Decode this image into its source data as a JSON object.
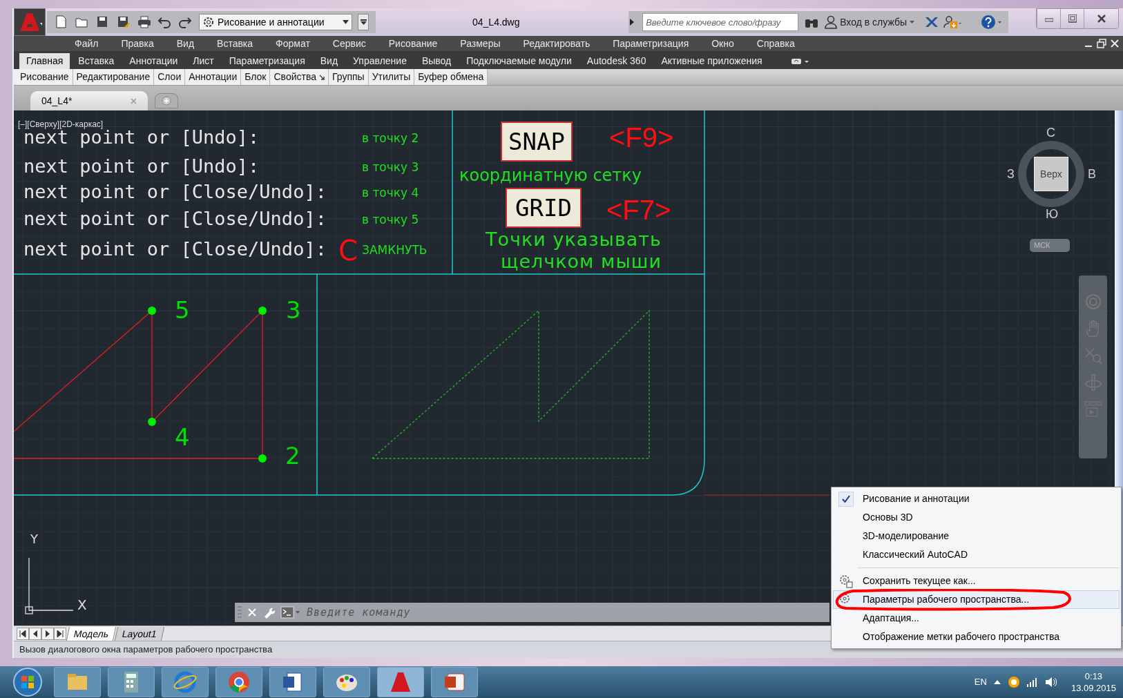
{
  "title_bar": {
    "workspace": "Рисование и аннотации",
    "document_title": "04_L4.dwg",
    "search": {
      "placeholder": "Введите ключевое слово/фразу"
    },
    "sign_in": "Вход в службы"
  },
  "menu_bar": [
    "Файл",
    "Правка",
    "Вид",
    "Вставка",
    "Формат",
    "Сервис",
    "Рисование",
    "Размеры",
    "Редактировать",
    "Параметризация",
    "Окно",
    "Справка"
  ],
  "ribbon_tabs": [
    {
      "label": "Главная",
      "selected": true
    },
    {
      "label": "Вставка",
      "selected": false
    },
    {
      "label": "Аннотации",
      "selected": false
    },
    {
      "label": "Лист",
      "selected": false
    },
    {
      "label": "Параметризация",
      "selected": false
    },
    {
      "label": "Вид",
      "selected": false
    },
    {
      "label": "Управление",
      "selected": false
    },
    {
      "label": "Вывод",
      "selected": false
    },
    {
      "label": "Подключаемые модули",
      "selected": false
    },
    {
      "label": "Autodesk 360",
      "selected": false
    },
    {
      "label": "Активные приложения",
      "selected": false
    }
  ],
  "ribbon_panels": [
    {
      "label": "Рисование",
      "launcher": false
    },
    {
      "label": "Редактирование",
      "launcher": false
    },
    {
      "label": "Слои",
      "launcher": false
    },
    {
      "label": "Аннотации",
      "launcher": false
    },
    {
      "label": "Блок",
      "launcher": false
    },
    {
      "label": "Свойства",
      "launcher": true
    },
    {
      "label": "Группы",
      "launcher": false
    },
    {
      "label": "Утилиты",
      "launcher": false
    },
    {
      "label": "Буфер обмена",
      "launcher": false
    }
  ],
  "file_tabs": [
    {
      "label": "04_L4*",
      "selected": true
    }
  ],
  "viewport_label": "[–][Сверху][2D-каркас]",
  "command_history": [
    {
      "prompt": "next point or [Undo]:",
      "note": "в точку 2"
    },
    {
      "prompt": "next point or [Undo]:",
      "note": "в точку 3"
    },
    {
      "prompt": "next point or [Close/Undo]:",
      "note": "в точку 4"
    },
    {
      "prompt": "next point or [Close/Undo]:",
      "note": "в точку 5"
    },
    {
      "prompt": "next point or [Close/Undo]:",
      "input": "C",
      "note": "ЗАМКНУТЬ"
    }
  ],
  "snap": {
    "button": "SNAP",
    "shortcut": "<F9>",
    "caption": "координатную сетку"
  },
  "grid": {
    "button": "GRID",
    "shortcut": "<F7>",
    "caption": [
      "Точки указывать",
      "щелчком мыши"
    ]
  },
  "point_labels": [
    "5",
    "3",
    "4",
    "2"
  ],
  "ucs_icon": {
    "y_label": "Y",
    "x_label": "X"
  },
  "viewcube": {
    "north": "С",
    "west": "З",
    "east": "В",
    "south": "Ю",
    "face": "Верх",
    "ucs_button": "МСК"
  },
  "command_line": {
    "placeholder": "Введите команду"
  },
  "layout_tabs": [
    {
      "label": "Модель",
      "selected": true
    },
    {
      "label": "Layout1",
      "selected": false
    }
  ],
  "status_bar": {
    "text": "Вызов диалогового окна параметров рабочего пространства"
  },
  "workspace_menu": [
    {
      "label": "Рисование и аннотации",
      "kind": "workspace",
      "checked": true,
      "highlighted": false
    },
    {
      "label": "Основы 3D",
      "kind": "workspace",
      "checked": false,
      "highlighted": false
    },
    {
      "label": "3D-моделирование",
      "kind": "workspace",
      "checked": false,
      "highlighted": false
    },
    {
      "label": "Классический AutoCAD",
      "kind": "workspace",
      "checked": false,
      "highlighted": false
    },
    {
      "label": "Сохранить текущее как...",
      "kind": "action",
      "checked": false,
      "highlighted": false
    },
    {
      "label": "Параметры рабочего пространства...",
      "kind": "action",
      "checked": false,
      "highlighted": true
    },
    {
      "label": "Адаптация...",
      "kind": "action",
      "checked": false,
      "highlighted": false
    },
    {
      "label": "Отображение метки рабочего пространства",
      "kind": "action",
      "checked": false,
      "highlighted": false
    }
  ],
  "taskbar": {
    "language": "EN",
    "time": "0:13",
    "date": "13.09.2015"
  }
}
